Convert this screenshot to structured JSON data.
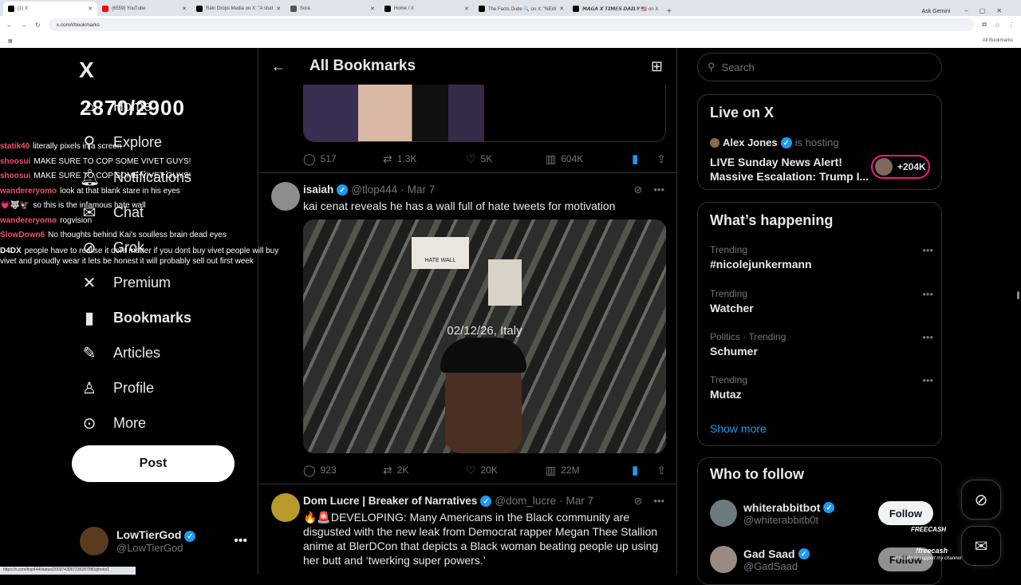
{
  "browser": {
    "tabs": [
      {
        "title": "(1) X"
      },
      {
        "title": "(6559) YouTube"
      },
      {
        "title": "Rain Drops Media on X: \"A stud"
      },
      {
        "title": "Sora"
      },
      {
        "title": "Home / X"
      },
      {
        "title": "The Facts Dude 🔍 on X: \"NEW"
      },
      {
        "title": "𝙈𝘼𝙂𝘼 𝙓 𝙏𝙄𝙈𝙀𝙎 𝘿𝘼𝙄𝙇𝙔 🇺🇸 on X"
      }
    ],
    "new_tab": "+",
    "ask_gemini": "Ask Gemini",
    "url": "x.com/i/bookmarks",
    "all_bookmarks": "All Bookmarks",
    "status_url": "https://x.com/tlop444/status/2003743067235287980/photo/1"
  },
  "sidebar": {
    "logo": "X",
    "nav": [
      {
        "label": "Home",
        "icon": "home-icon"
      },
      {
        "label": "Explore",
        "icon": "search-icon"
      },
      {
        "label": "Notifications",
        "icon": "bell-icon"
      },
      {
        "label": "Chat",
        "icon": "mail-icon"
      },
      {
        "label": "Grok",
        "icon": "grok-icon"
      },
      {
        "label": "Premium",
        "icon": "premium-icon"
      },
      {
        "label": "Bookmarks",
        "icon": "bookmark-icon"
      },
      {
        "label": "Articles",
        "icon": "article-icon"
      },
      {
        "label": "Profile",
        "icon": "person-icon"
      },
      {
        "label": "More",
        "icon": "more-circle-icon"
      }
    ],
    "post_label": "Post",
    "account": {
      "name": "LowTierGod",
      "handle": "@LowTierGod"
    }
  },
  "stream_overlay": {
    "counter": "2870/2900",
    "chat": [
      {
        "user": "statik40",
        "message": "literally pixels in a screen"
      },
      {
        "user": "shoosui",
        "message": "MAKE SURE TO COP SOME VIVET GUYS!"
      },
      {
        "user": "shoosui",
        "message": "MAKE SURE TO COP SOME VIVET GUYS!"
      },
      {
        "user": "wandereryomo",
        "message": "look at that blank stare in his eyes"
      },
      {
        "user": "💗🐺🦅",
        "message": "so this is the infamous hate wall"
      },
      {
        "user": "wandereryomo",
        "message": "rogvision"
      },
      {
        "user": "SlowDown6",
        "message": "No thoughts behind Kai's soulless brain dead eyes"
      },
      {
        "user": "D4DX",
        "message": "people have to realise it dont matter if you dont buy vivet people will buy vivet and proudly wear it lets be honest it will probably sell out first week"
      }
    ]
  },
  "main": {
    "header_title": "All Bookmarks",
    "posts": [
      {
        "stats": {
          "replies": "517",
          "reposts": "1.3K",
          "likes": "5K",
          "views": "604K"
        }
      },
      {
        "name": "isaiah",
        "handle": "@tlop444",
        "date": "Mar 7",
        "text": "kai cenat reveals he has a wall full of hate tweets for motivation",
        "photo_sign": "HATE WALL",
        "photo_stamp": "02/12/26, Italy",
        "stats": {
          "replies": "923",
          "reposts": "2K",
          "likes": "20K",
          "views": "22M"
        }
      },
      {
        "name": "Dom Lucre | Breaker of Narratives",
        "handle": "@dom_lucre",
        "date": "Mar 7",
        "text": "🔥🚨DEVELOPING: Many Americans in the Black community are disgusted with the new leak from Democrat rapper Megan Thee Stallion anime at BlerDCon that depicts a Black woman beating people up using her butt and ‘twerking super powers.’"
      }
    ]
  },
  "right": {
    "search_placeholder": "Search",
    "live": {
      "title": "Live on X",
      "host": "Alex Jones",
      "hosting_label": "is hosting",
      "stream_title": "LIVE Sunday News Alert! Massive Escalation: Trump I...",
      "listeners": "+204K"
    },
    "happening": {
      "title": "What’s happening",
      "trends": [
        {
          "context": "Trending",
          "name": "#nicolejunkermann"
        },
        {
          "context": "Trending",
          "name": "Watcher"
        },
        {
          "context": "Politics · Trending",
          "name": "Schumer"
        },
        {
          "context": "Trending",
          "name": "Mutaz"
        }
      ],
      "show_more": "Show more"
    },
    "who_to_follow": {
      "title": "Who to follow",
      "accounts": [
        {
          "name": "whiterabbitbot",
          "handle": "@whiterabbitb0t",
          "button": "Follow"
        },
        {
          "name": "Gad Saad",
          "handle": "@GadSaad",
          "button": "Follow"
        }
      ]
    },
    "promo": {
      "brand": "FREECASH",
      "handle": "!freecash",
      "sub": "use code to support my channel"
    }
  }
}
